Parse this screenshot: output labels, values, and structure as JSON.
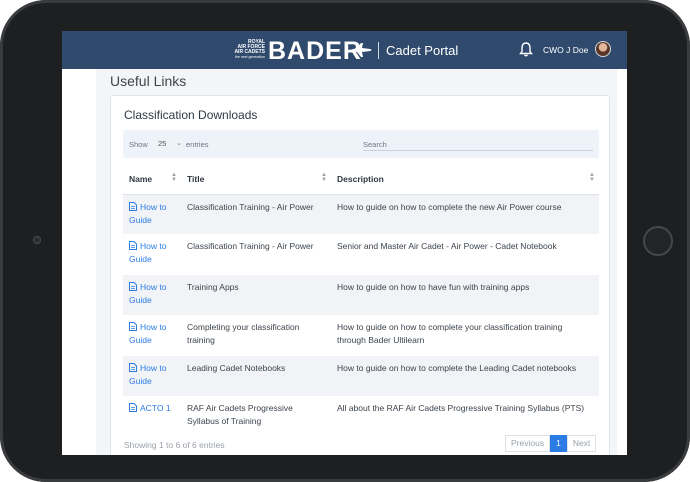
{
  "header": {
    "brand_small_line1": "ROYAL",
    "brand_small_line2": "AIR FORCE",
    "brand_small_line3": "AIR CADETS",
    "brand_small_line4": "the next generation",
    "brand_name": "BADER",
    "portal_title": "Cadet Portal",
    "user_name": "CWO J Doe",
    "colors": {
      "bar": "#2f4a6d",
      "link": "#2b7be4"
    }
  },
  "page": {
    "title": "Useful Links"
  },
  "card": {
    "title": "Classification Downloads",
    "show_label": "Show",
    "entries_value": "25",
    "entries_label": "entries",
    "search_label": "Search",
    "columns": [
      "Name",
      "Title",
      "Description"
    ],
    "rows": [
      {
        "name": "How to Guide",
        "title": "Classification Training - Air Power",
        "description": "How to guide on how to complete the new Air Power course",
        "icon": "file-icon"
      },
      {
        "name": "How to Guide",
        "title": "Classification Training - Air Power",
        "description": "Senior and Master Air Cadet - Air Power - Cadet Notebook",
        "icon": "file-icon"
      },
      {
        "name": "How to Guide",
        "title": "Training Apps",
        "description": "How to guide on how to have fun with training apps",
        "icon": "file-icon"
      },
      {
        "name": "How to Guide",
        "title": "Completing your classification training",
        "description": "How to guide on how to complete your classification training through Bader Ultilearn",
        "icon": "file-icon"
      },
      {
        "name": "How to Guide",
        "title": "Leading Cadet Notebooks",
        "description": "How to guide on how to complete the Leading Cadet notebooks",
        "icon": "file-icon"
      },
      {
        "name": "ACTO 1",
        "title": "RAF Air Cadets Progressive Syllabus of Training",
        "description": "All about the RAF Air Cadets Progressive Training Syllabus (PTS)",
        "icon": "file-icon"
      }
    ],
    "footer_info": "Showing 1 to 6 of 6 entries",
    "pager": {
      "previous": "Previous",
      "current": "1",
      "next": "Next"
    }
  }
}
